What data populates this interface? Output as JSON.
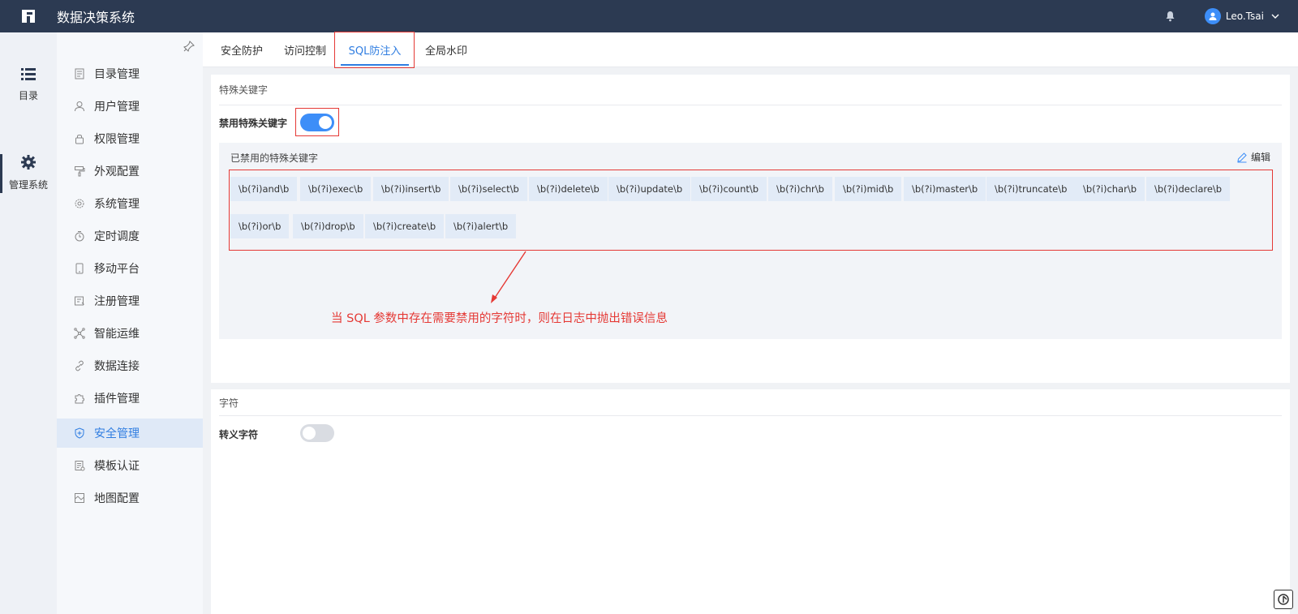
{
  "app": {
    "title": "数据决策系统"
  },
  "user": {
    "name": "Leo.Tsai"
  },
  "rail": {
    "items": [
      {
        "label": "目录",
        "icon": "list-icon"
      },
      {
        "label": "管理系统",
        "icon": "gear-icon"
      }
    ]
  },
  "sidebar": {
    "items": [
      {
        "label": "目录管理",
        "icon": "catalog-icon"
      },
      {
        "label": "用户管理",
        "icon": "user-icon"
      },
      {
        "label": "权限管理",
        "icon": "lock-icon"
      },
      {
        "label": "外观配置",
        "icon": "paint-roller-icon"
      },
      {
        "label": "系统管理",
        "icon": "settings-icon"
      },
      {
        "label": "定时调度",
        "icon": "timer-icon"
      },
      {
        "label": "移动平台",
        "icon": "mobile-icon"
      },
      {
        "label": "注册管理",
        "icon": "register-icon"
      },
      {
        "label": "智能运维",
        "icon": "network-icon"
      },
      {
        "label": "数据连接",
        "icon": "link-icon"
      },
      {
        "label": "插件管理",
        "icon": "puzzle-icon"
      },
      {
        "label": "安全管理",
        "icon": "shield-icon",
        "active": true
      },
      {
        "label": "模板认证",
        "icon": "template-icon"
      },
      {
        "label": "地图配置",
        "icon": "map-icon"
      }
    ]
  },
  "tabs": [
    {
      "label": "安全防护"
    },
    {
      "label": "访问控制"
    },
    {
      "label": "SQL防注入",
      "active": true
    },
    {
      "label": "全局水印"
    }
  ],
  "special_keywords": {
    "section_title": "特殊关键字",
    "toggle_label": "禁用特殊关键字",
    "toggle_on": true,
    "panel_title": "已禁用的特殊关键字",
    "edit_label": "编辑",
    "keywords": [
      "\\b(?i)and\\b",
      "\\b(?i)exec\\b",
      "\\b(?i)insert\\b",
      "\\b(?i)select\\b",
      "\\b(?i)delete\\b",
      "\\b(?i)update\\b",
      "\\b(?i)count\\b",
      "\\b(?i)chr\\b",
      "\\b(?i)mid\\b",
      "\\b(?i)master\\b",
      "\\b(?i)truncate\\b",
      "\\b(?i)char\\b",
      "\\b(?i)declare\\b",
      "\\b(?i)or\\b",
      "\\b(?i)drop\\b",
      "\\b(?i)create\\b",
      "\\b(?i)alert\\b"
    ],
    "annotation": "当 SQL 参数中存在需要禁用的字符时，则在日志中抛出错误信息"
  },
  "characters": {
    "section_title": "字符",
    "toggle_label": "转义字符",
    "toggle_on": false
  },
  "colors": {
    "topbar": "#2c3a52",
    "accent": "#2f7de1",
    "highlight": "#e53935"
  }
}
